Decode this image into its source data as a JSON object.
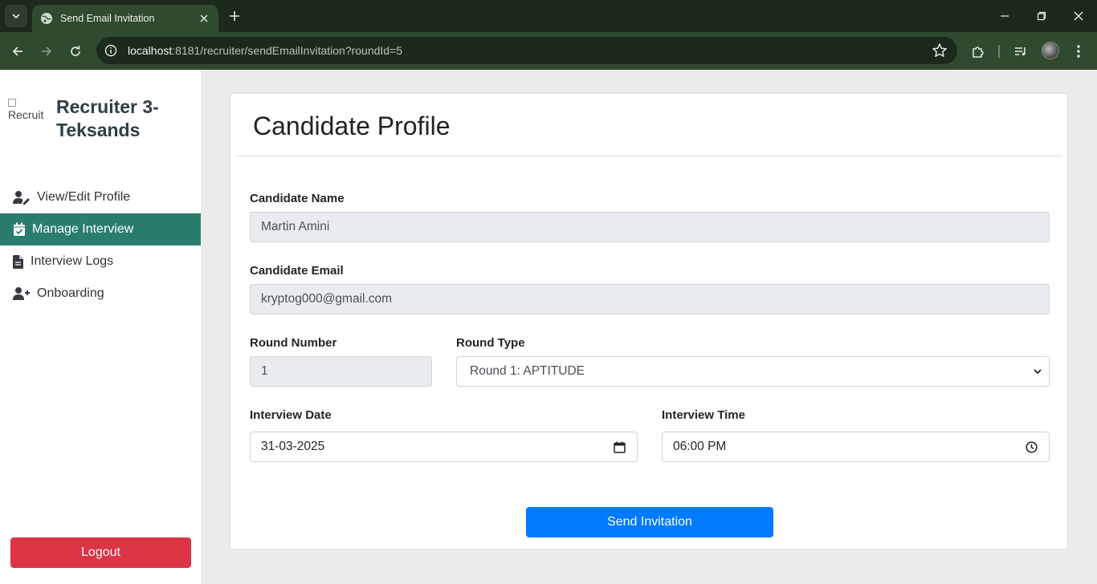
{
  "browser": {
    "tab_title": "Send Email Invitation",
    "url_host": "localhost",
    "url_rest": ":8181/recruiter/sendEmailInvitation?roundId=5"
  },
  "sidebar": {
    "brand_alt": "Recruit",
    "brand_name": "Recruiter 3-Teksands",
    "items": [
      {
        "label": "View/Edit Profile",
        "icon": "user-edit-icon"
      },
      {
        "label": "Manage Interview",
        "icon": "calendar-check-icon",
        "active": true
      },
      {
        "label": "Interview Logs",
        "icon": "file-icon"
      },
      {
        "label": "Onboarding",
        "icon": "user-plus-icon"
      }
    ],
    "logout_label": "Logout"
  },
  "form": {
    "title": "Candidate Profile",
    "candidate_name_label": "Candidate Name",
    "candidate_name": "Martin Amini",
    "candidate_email_label": "Candidate Email",
    "candidate_email": "kryptog000@gmail.com",
    "round_number_label": "Round Number",
    "round_number": "1",
    "round_type_label": "Round Type",
    "round_type": "Round 1: APTITUDE",
    "interview_date_label": "Interview Date",
    "interview_date": "31-03-2025",
    "interview_time_label": "Interview Time",
    "interview_time": "06:00 PM",
    "send_label": "Send Invitation"
  },
  "colors": {
    "active_nav": "#2a7d6d",
    "logout": "#dc3545",
    "primary": "#007bff"
  }
}
